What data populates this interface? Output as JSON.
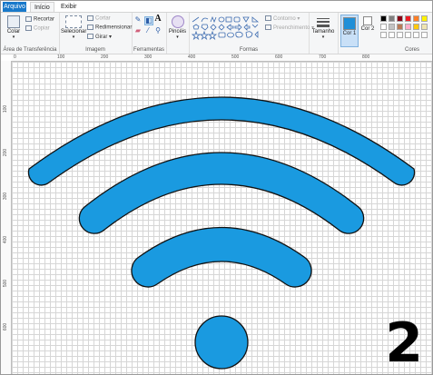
{
  "tabs": {
    "file": "Arquivo",
    "home": "Início",
    "view": "Exibir"
  },
  "clipboard": {
    "paste": "Colar",
    "cut": "Recortar",
    "copy": "Copiar",
    "group": "Área de Transferência"
  },
  "image": {
    "select": "Selecionar",
    "crop": "Cortar",
    "resize": "Redimensionar",
    "rotate": "Girar",
    "group": "Imagem"
  },
  "tools": {
    "group": "Ferramentas",
    "text_glyph": "A"
  },
  "brushes": {
    "label": "Pincéis"
  },
  "shapes": {
    "outline": "Contorno",
    "fill": "Preenchimento",
    "group": "Formas"
  },
  "size": {
    "label": "Tamanho"
  },
  "colors": {
    "color1": "Cor 1",
    "color2": "Cor 2",
    "group": "Cores",
    "color1_value": "#1f8fd8",
    "color2_value": "#ffffff",
    "palette": [
      "#000000",
      "#7f7f7f",
      "#880015",
      "#ed1c24",
      "#ff7f27",
      "#fff200",
      "#ffffff",
      "#c3c3c3",
      "#b97a57",
      "#ffaec9",
      "#ffc90e",
      "#efe4b0",
      "#ffffff",
      "#ffffff",
      "#ffffff",
      "#ffffff",
      "#ffffff",
      "#ffffff"
    ]
  },
  "ruler": {
    "top": [
      "0",
      "100",
      "200",
      "300",
      "400",
      "500",
      "600",
      "700",
      "800"
    ],
    "left": [
      "100",
      "200",
      "300",
      "400",
      "500",
      "600"
    ]
  },
  "wifi": {
    "fill": "#1a9ae0",
    "stroke": "#111111"
  },
  "badge": "2"
}
